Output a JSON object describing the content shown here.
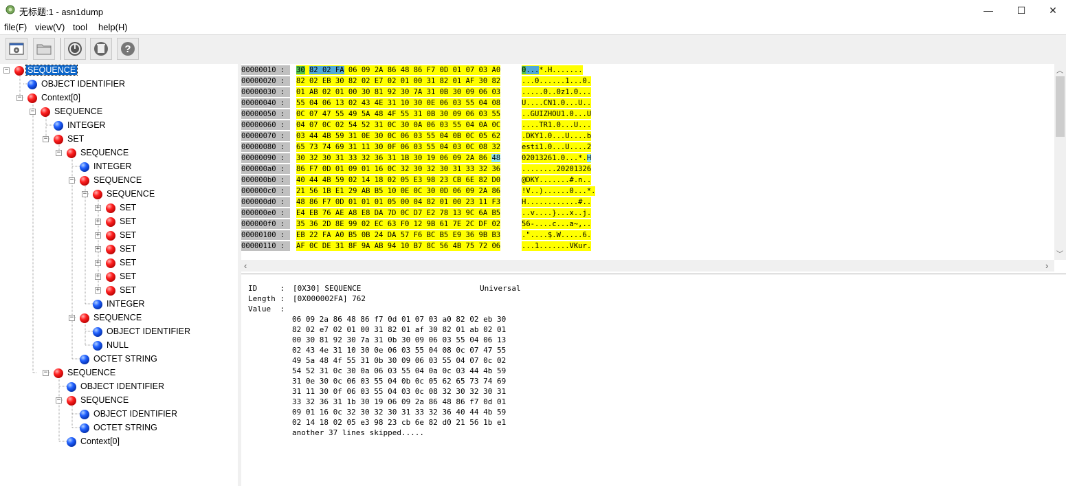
{
  "window": {
    "title": "无标题:1 - asn1dump",
    "minimize_glyph": "—",
    "maximize_glyph": "☐",
    "close_glyph": "✕"
  },
  "menu": [
    "file(F)",
    "view(V)",
    "tool",
    "help(H)"
  ],
  "toolbar": {
    "buttons": [
      {
        "icon": "wizard-icon"
      },
      {
        "icon": "open-folder-icon"
      },
      {
        "icon": "power-icon"
      },
      {
        "icon": "clear-icon"
      },
      {
        "icon": "help-icon"
      }
    ]
  },
  "tree": [
    {
      "label": "SEQUENCE",
      "color": "red",
      "selected": true
    },
    {
      "label": "OBJECT IDENTIFIER",
      "color": "blue"
    },
    {
      "label": "Context[0]",
      "color": "red"
    },
    {
      "label": "SEQUENCE",
      "color": "red"
    },
    {
      "label": "INTEGER",
      "color": "blue"
    },
    {
      "label": "SET",
      "color": "red"
    },
    {
      "label": "SEQUENCE",
      "color": "red"
    },
    {
      "label": "INTEGER",
      "color": "blue"
    },
    {
      "label": "SEQUENCE",
      "color": "red"
    },
    {
      "label": "SEQUENCE",
      "color": "red"
    },
    {
      "label": "SET",
      "color": "red"
    },
    {
      "label": "SET",
      "color": "red"
    },
    {
      "label": "SET",
      "color": "red"
    },
    {
      "label": "SET",
      "color": "red"
    },
    {
      "label": "SET",
      "color": "red"
    },
    {
      "label": "SET",
      "color": "red"
    },
    {
      "label": "SET",
      "color": "red"
    },
    {
      "label": "INTEGER",
      "color": "blue"
    },
    {
      "label": "SEQUENCE",
      "color": "red"
    },
    {
      "label": "OBJECT IDENTIFIER",
      "color": "blue"
    },
    {
      "label": "NULL",
      "color": "blue"
    },
    {
      "label": "OCTET STRING",
      "color": "blue"
    },
    {
      "label": "SEQUENCE",
      "color": "red"
    },
    {
      "label": "OBJECT IDENTIFIER",
      "color": "blue"
    },
    {
      "label": "SEQUENCE",
      "color": "red"
    },
    {
      "label": "OBJECT IDENTIFIER",
      "color": "blue"
    },
    {
      "label": "OCTET STRING",
      "color": "blue"
    },
    {
      "label": "Context[0]",
      "color": "blue"
    }
  ],
  "hex": {
    "rows": [
      {
        "addr": "00000010 :",
        "bytes": "30 82 02 FA 06 09 2A 86 48 86 F7 0D 01 07 03 A0",
        "ascii": "0...*.H......."
      },
      {
        "addr": "00000020 :",
        "bytes": "82 02 EB 30 82 02 E7 02 01 00 31 82 01 AF 30 82",
        "ascii": "...0......1...0."
      },
      {
        "addr": "00000030 :",
        "bytes": "01 AB 02 01 00 30 81 92 30 7A 31 0B 30 09 06 03",
        "ascii": ".....0..0z1.0..."
      },
      {
        "addr": "00000040 :",
        "bytes": "55 04 06 13 02 43 4E 31 10 30 0E 06 03 55 04 08",
        "ascii": "U....CN1.0...U.."
      },
      {
        "addr": "00000050 :",
        "bytes": "0C 07 47 55 49 5A 48 4F 55 31 0B 30 09 06 03 55",
        "ascii": "..GUIZHOU1.0...U"
      },
      {
        "addr": "00000060 :",
        "bytes": "04 07 0C 02 54 52 31 0C 30 0A 06 03 55 04 0A 0C",
        "ascii": "....TR1.0...U..."
      },
      {
        "addr": "00000070 :",
        "bytes": "03 44 4B 59 31 0E 30 0C 06 03 55 04 0B 0C 05 62",
        "ascii": ".DKY1.0...U....b"
      },
      {
        "addr": "00000080 :",
        "bytes": "65 73 74 69 31 11 30 0F 06 03 55 04 03 0C 08 32",
        "ascii": "esti1.0...U....2"
      },
      {
        "addr": "00000090 :",
        "bytes": "30 32 30 31 33 32 36 31 1B 30 19 06 09 2A 86 48",
        "ascii": "02013261.0...*.H"
      },
      {
        "addr": "000000a0 :",
        "bytes": "86 F7 0D 01 09 01 16 0C 32 30 32 30 31 33 32 36",
        "ascii": "........20201326"
      },
      {
        "addr": "000000b0 :",
        "bytes": "40 44 4B 59 02 14 18 02 05 E3 98 23 CB 6E 82 D0",
        "ascii": "@DKY.......#.n.."
      },
      {
        "addr": "000000c0 :",
        "bytes": "21 56 1B E1 29 AB B5 10 0E 0C 30 0D 06 09 2A 86",
        "ascii": "!V..)......0...*."
      },
      {
        "addr": "000000d0 :",
        "bytes": "48 86 F7 0D 01 01 01 05 00 04 82 01 00 23 11 F3",
        "ascii": "H............#.."
      },
      {
        "addr": "000000e0 :",
        "bytes": "E4 EB 76 AE A8 E8 DA 7D 0C D7 E2 78 13 9C 6A B5",
        "ascii": "..v....}...x..j."
      },
      {
        "addr": "000000f0 :",
        "bytes": "35 36 2D 8E 99 02 EC 63 F0 12 9B 61 7E 2C DF 02",
        "ascii": "56-....c...a~,.."
      },
      {
        "addr": "00000100 :",
        "bytes": "EB 22 FA A0 B5 0B 24 DA 57 F6 BC B5 E9 36 9B B3",
        "ascii": ".\"....$.W.....6."
      },
      {
        "addr": "00000110 :",
        "bytes": "AF 0C DE 31 8F 9A AB 94 10 B7 8C 56 4B 75 72 06",
        "ascii": "...1.......VKur."
      }
    ],
    "first_row_parts": {
      "tag": "30",
      "len": "82 02 FA",
      "rest": " 06 09 2A 86 48 86 F7 0D 01 07 03 A0",
      "ascii_tag": "0",
      "ascii_len": "...",
      "ascii_rest": "*.H......."
    },
    "row9_parts": {
      "pre": "30 32 30 31 33 32 36 31 1B 30 19 06 09 2A 86 ",
      "hl": "48",
      "ascii_pre": "02013261.0...*.",
      "ascii_hl": "H"
    },
    "scroll_up": "︿",
    "scroll_down": "﹀",
    "scroll_left": "‹",
    "scroll_right": "›"
  },
  "detail": {
    "id_key": "ID     :",
    "id_val": "[0X30] SEQUENCE",
    "id_class": "Universal",
    "length_key": "Length :",
    "length_val": "[0X000002FA] 762",
    "value_key": "Value  :",
    "lines": [
      "06 09 2a 86 48 86 f7 0d 01 07 03 a0 82 02 eb 30",
      "82 02 e7 02 01 00 31 82 01 af 30 82 01 ab 02 01",
      "00 30 81 92 30 7a 31 0b 30 09 06 03 55 04 06 13",
      "02 43 4e 31 10 30 0e 06 03 55 04 08 0c 07 47 55",
      "49 5a 48 4f 55 31 0b 30 09 06 03 55 04 07 0c 02",
      "54 52 31 0c 30 0a 06 03 55 04 0a 0c 03 44 4b 59",
      "31 0e 30 0c 06 03 55 04 0b 0c 05 62 65 73 74 69",
      "31 11 30 0f 06 03 55 04 03 0c 08 32 30 32 30 31",
      "33 32 36 31 1b 30 19 06 09 2a 86 48 86 f7 0d 01",
      "09 01 16 0c 32 30 32 30 31 33 32 36 40 44 4b 59",
      "02 14 18 02 05 e3 98 23 cb 6e 82 d0 21 56 1b e1"
    ],
    "skipped": "another 37 lines skipped....."
  }
}
